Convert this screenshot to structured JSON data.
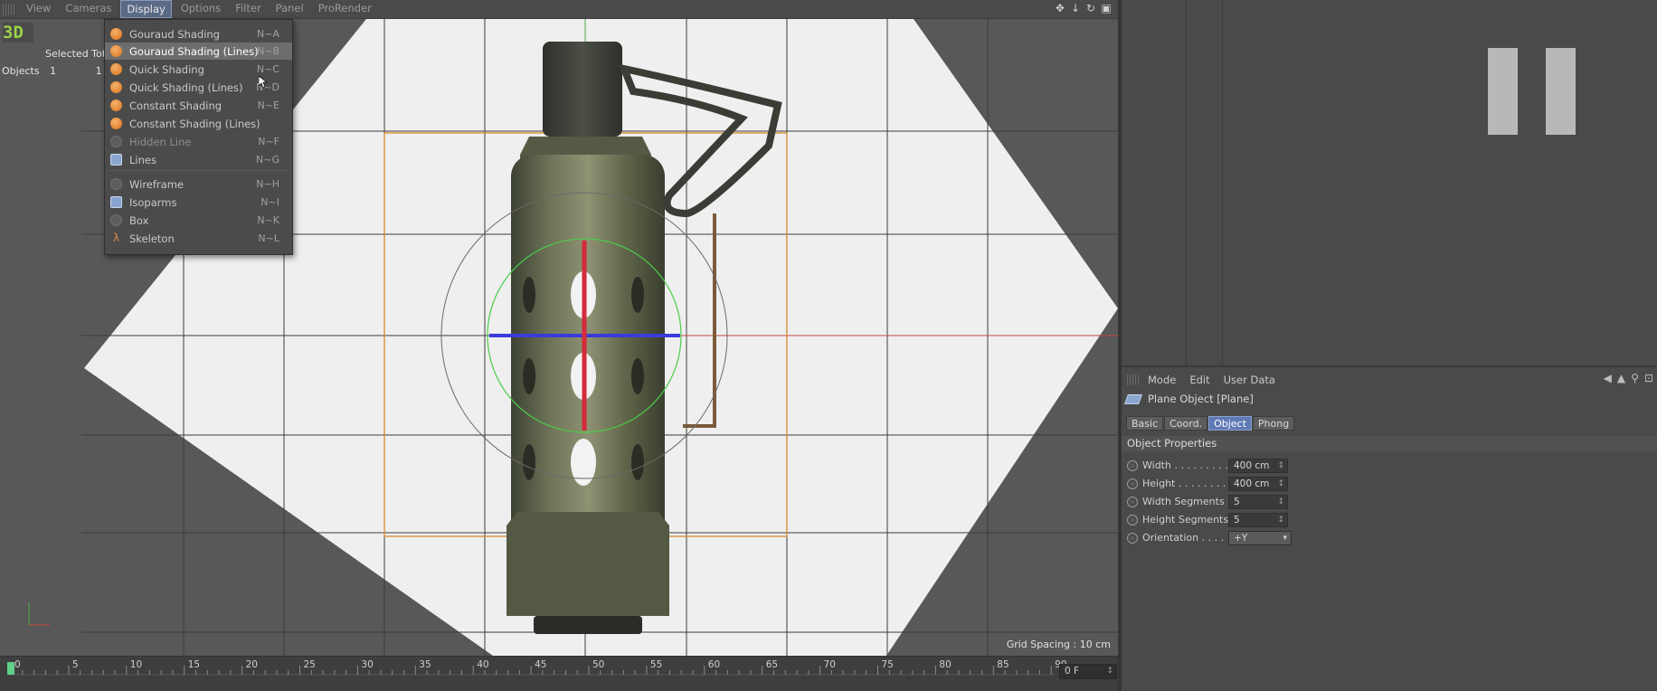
{
  "viewport": {
    "menus": [
      {
        "label": "View",
        "active": false
      },
      {
        "label": "Cameras",
        "active": false
      },
      {
        "label": "Display",
        "active": true
      },
      {
        "label": "Options",
        "active": false
      },
      {
        "label": "Filter",
        "active": false
      },
      {
        "label": "Panel",
        "active": false
      },
      {
        "label": "ProRender",
        "active": false
      }
    ],
    "right_icons": [
      "move-view-icon",
      "pan-down-icon",
      "rotate-view-icon",
      "maximize-view-icon"
    ],
    "logo_text": "3D",
    "hud": {
      "header_selected": "Selected Tot",
      "row_label": "Objects",
      "row_selected": "1",
      "row_total": "1"
    },
    "grid_spacing": "Grid Spacing : 10 cm"
  },
  "display_menu": {
    "items": [
      {
        "label": "Gouraud Shading",
        "shortcut": "N~A",
        "icon": "gouraud-shading-icon",
        "icon_style": "orange",
        "highlighted": false,
        "dim": false
      },
      {
        "label": "Gouraud Shading (Lines)",
        "shortcut": "N~B",
        "icon": "gouraud-lines-icon",
        "icon_style": "orange",
        "highlighted": true,
        "dim": false
      },
      {
        "label": "Quick Shading",
        "shortcut": "N~C",
        "icon": "quick-shading-icon",
        "icon_style": "orange",
        "highlighted": false,
        "dim": false
      },
      {
        "label": "Quick Shading (Lines)",
        "shortcut": "N~D",
        "icon": "quick-lines-icon",
        "icon_style": "orange",
        "highlighted": false,
        "dim": false
      },
      {
        "label": "Constant Shading",
        "shortcut": "N~E",
        "icon": "constant-shading-icon",
        "icon_style": "orange",
        "highlighted": false,
        "dim": false
      },
      {
        "label": "Constant Shading (Lines)",
        "shortcut": "",
        "icon": "constant-lines-icon",
        "icon_style": "orange",
        "highlighted": false,
        "dim": false
      },
      {
        "label": "Hidden Line",
        "shortcut": "N~F",
        "icon": "hidden-line-icon",
        "icon_style": "grey",
        "highlighted": false,
        "dim": true
      },
      {
        "label": "Lines",
        "shortcut": "N~G",
        "icon": "lines-icon",
        "icon_style": "blue",
        "highlighted": false,
        "dim": false
      },
      {
        "label": "Wireframe",
        "shortcut": "N~H",
        "icon": "wireframe-icon",
        "icon_style": "grey",
        "highlighted": false,
        "dim": false
      },
      {
        "label": "Isoparms",
        "shortcut": "N~I",
        "icon": "isoparms-icon",
        "icon_style": "blue",
        "highlighted": false,
        "dim": false
      },
      {
        "label": "Box",
        "shortcut": "N~K",
        "icon": "box-icon",
        "icon_style": "grey",
        "highlighted": false,
        "dim": false
      },
      {
        "label": "Skeleton",
        "shortcut": "N~L",
        "icon": "skeleton-icon",
        "icon_style": "skel",
        "highlighted": false,
        "dim": false
      }
    ]
  },
  "timeline": {
    "ticks": [
      "0",
      "5",
      "10",
      "15",
      "20",
      "25",
      "30",
      "35",
      "40",
      "45",
      "50",
      "55",
      "60",
      "65",
      "70",
      "75",
      "80",
      "85",
      "90"
    ],
    "current_frame": "0 F"
  },
  "attributes": {
    "menus": [
      "Mode",
      "Edit",
      "User Data"
    ],
    "object_title": "Plane Object [Plane]",
    "tabs": [
      {
        "label": "Basic",
        "active": false
      },
      {
        "label": "Coord.",
        "active": false
      },
      {
        "label": "Object",
        "active": true
      },
      {
        "label": "Phong",
        "active": false
      }
    ],
    "section_title": "Object Properties",
    "properties": [
      {
        "label": "Width . . . . . . . . .",
        "value": "400 cm",
        "type": "number"
      },
      {
        "label": "Height . . . . . . . .",
        "value": "400 cm",
        "type": "number"
      },
      {
        "label": "Width Segments",
        "value": "5",
        "type": "number"
      },
      {
        "label": "Height Segments",
        "value": "5",
        "type": "number"
      },
      {
        "label": "Orientation . . . .",
        "value": "+Y",
        "type": "select"
      }
    ]
  }
}
